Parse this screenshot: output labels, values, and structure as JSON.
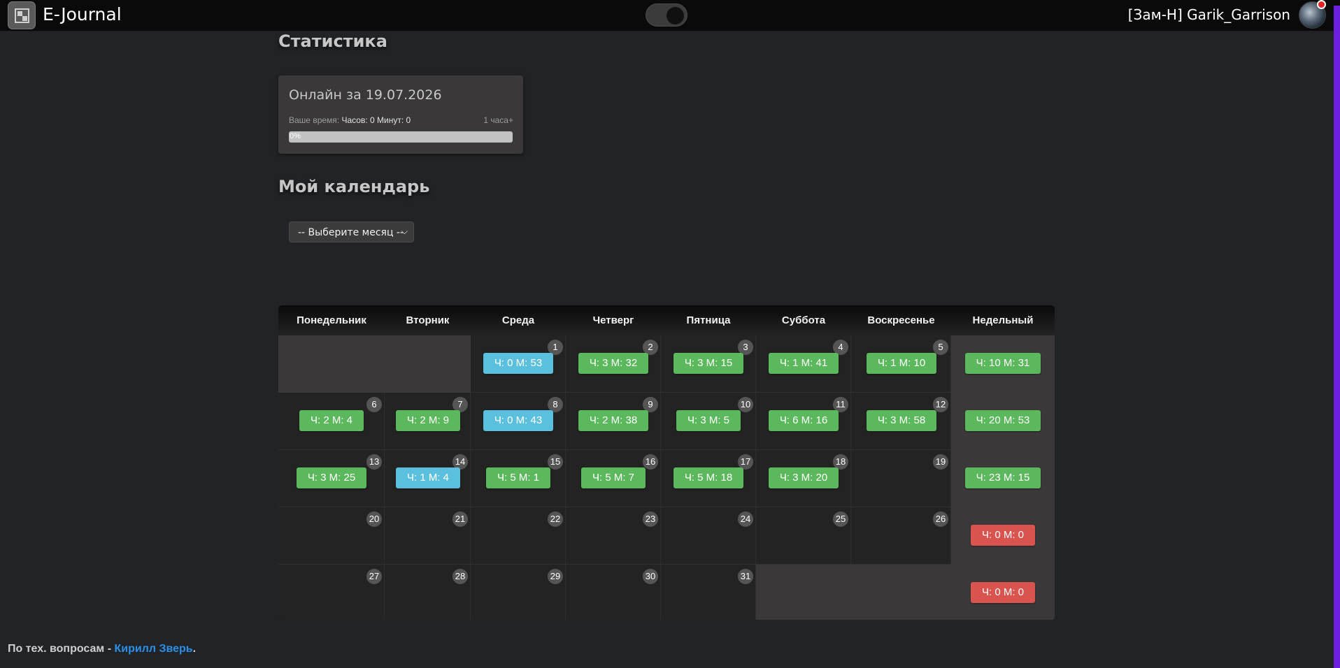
{
  "app": {
    "title": "E-Journal"
  },
  "header": {
    "username": "[Зам-Н] Garik_Garrison"
  },
  "stats": {
    "heading": "Статистика",
    "card_title": "Онлайн за 19.07.2026",
    "time_label": "Ваше время:",
    "time_value": "Часов: 0 Минут: 0",
    "goal": "1 часа+",
    "progress_percent": 0,
    "progress_text": "0%"
  },
  "calendar_section": {
    "heading": "Мой календарь",
    "month_select": {
      "value": "-- Выберите месяц --"
    }
  },
  "calendar": {
    "headers": [
      "Понедельник",
      "Вторник",
      "Среда",
      "Четверг",
      "Пятница",
      "Суббота",
      "Воскресенье",
      "Недельный"
    ],
    "leading_empty": 2,
    "days": [
      {
        "day": "1",
        "value": "Ч: 0 М: 53",
        "color": "blue"
      },
      {
        "day": "2",
        "value": "Ч: 3 М: 32",
        "color": "green"
      },
      {
        "day": "3",
        "value": "Ч: 3 М: 15",
        "color": "green"
      },
      {
        "day": "4",
        "value": "Ч: 1 М: 41",
        "color": "green"
      },
      {
        "day": "5",
        "value": "Ч: 1 М: 10",
        "color": "green"
      },
      {
        "day": "6",
        "value": "Ч: 2 М: 4",
        "color": "green"
      },
      {
        "day": "7",
        "value": "Ч: 2 М: 9",
        "color": "green"
      },
      {
        "day": "8",
        "value": "Ч: 0 М: 43",
        "color": "blue"
      },
      {
        "day": "9",
        "value": "Ч: 2 М: 38",
        "color": "green"
      },
      {
        "day": "10",
        "value": "Ч: 3 М: 5",
        "color": "green"
      },
      {
        "day": "11",
        "value": "Ч: 6 М: 16",
        "color": "green"
      },
      {
        "day": "12",
        "value": "Ч: 3 М: 58",
        "color": "green"
      },
      {
        "day": "13",
        "value": "Ч: 3 М: 25",
        "color": "green"
      },
      {
        "day": "14",
        "value": "Ч: 1 М: 4",
        "color": "blue"
      },
      {
        "day": "15",
        "value": "Ч: 5 М: 1",
        "color": "green"
      },
      {
        "day": "16",
        "value": "Ч: 5 М: 7",
        "color": "green"
      },
      {
        "day": "17",
        "value": "Ч: 5 М: 18",
        "color": "green"
      },
      {
        "day": "18",
        "value": "Ч: 3 М: 20",
        "color": "green"
      },
      {
        "day": "19",
        "value": "",
        "color": ""
      },
      {
        "day": "20",
        "value": "",
        "color": ""
      },
      {
        "day": "21",
        "value": "",
        "color": ""
      },
      {
        "day": "22",
        "value": "",
        "color": ""
      },
      {
        "day": "23",
        "value": "",
        "color": ""
      },
      {
        "day": "24",
        "value": "",
        "color": ""
      },
      {
        "day": "25",
        "value": "",
        "color": ""
      },
      {
        "day": "26",
        "value": "",
        "color": ""
      },
      {
        "day": "27",
        "value": "",
        "color": ""
      },
      {
        "day": "28",
        "value": "",
        "color": ""
      },
      {
        "day": "29",
        "value": "",
        "color": ""
      },
      {
        "day": "30",
        "value": "",
        "color": ""
      },
      {
        "day": "31",
        "value": "",
        "color": ""
      }
    ],
    "weekly": [
      {
        "value": "Ч: 10 М: 31",
        "color": "green"
      },
      {
        "value": "Ч: 20 М: 53",
        "color": "green"
      },
      {
        "value": "Ч: 23 М: 15",
        "color": "green"
      },
      {
        "value": "Ч: 0 М: 0",
        "color": "red"
      },
      {
        "value": "Ч: 0 М: 0",
        "color": "red"
      }
    ]
  },
  "footer": {
    "text": "По тех. вопросам - ",
    "link": "Кирилл Зверь",
    "suffix": "."
  },
  "colors": {
    "green": "#5cb85c",
    "blue": "#5bc0de",
    "red": "#d9534f",
    "accent": "#6d1fe0",
    "link": "#2b8fe8"
  }
}
